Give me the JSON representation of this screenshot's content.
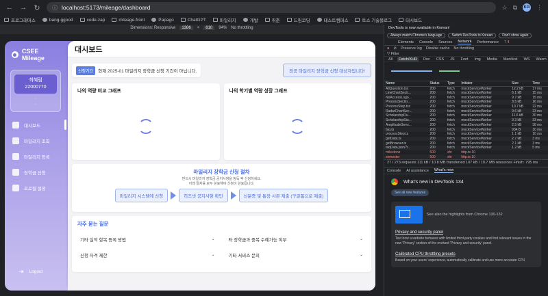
{
  "browser": {
    "url": "localhost:5173/mileage/dashboard",
    "bookmarks": [
      "프로그래머스",
      "bang-ggood",
      "code-zap",
      "mileage-front",
      "Papago",
      "ChatGPT",
      "마일리지",
      "개발",
      "취준",
      "드림코딩",
      "테스트캠퍼스",
      "토스 기술블로그",
      "대시보드"
    ],
    "profile_initials": "KG"
  },
  "device_toolbar": {
    "mode": "Dimensions: Responsive",
    "width": "1386",
    "height": "810",
    "zoom": "94%",
    "throttle": "No throttling"
  },
  "app": {
    "logo": "CSEE Mileage",
    "user": {
      "name": "최혜림",
      "id": "22000770",
      "dots": "·\n·"
    },
    "menu": [
      {
        "label": "대시보드",
        "active": true
      },
      {
        "label": "마일리지 조회"
      },
      {
        "label": "마일리지 등록"
      },
      {
        "label": "장학금 신청"
      },
      {
        "label": "프로필 설정"
      }
    ],
    "logout": "Logout",
    "page_title": "대시보드",
    "notice_badge": "신청기간",
    "notice_text": "현재 2025-01 마일리지 장학금 신청 기간이 아닙니다.",
    "target_button": "전공 마일리지 장학금 신청 대상자입니다!",
    "chart1_title": "나의 역량 비교 그래프",
    "chart2_title": "나의 학기별 역량 성장 그래프",
    "process_title": "마일리지 장학금 신청 절차",
    "process_desc1": "반드시 마일리지 장학금 공지사항을 정독 후 신청하세요.",
    "process_desc2": "아래 절차를 모두 완료해야 신청이 완료됩니다.",
    "steps": [
      "마일리지 시스템에 신청",
      "히즈넷 공지사항 확인",
      "신분증 및 통장 사본 제출 (구글폼으로 제출)"
    ],
    "faq_title": "자주 묻는 질문",
    "faq": [
      "기타 실적 항목 등록 방법",
      "타 장학금과 중복 수혜가능 여부",
      "신청 자격 제한",
      "기타 서비스 문의"
    ]
  },
  "devtools": {
    "notice": "DevTools is now available in Korean!",
    "btns": [
      "Always match Chrome's language",
      "Switch DevTools to Korean",
      "Don't show again"
    ],
    "tabs": [
      "Elements",
      "Console",
      "Sources",
      "Network",
      "Performance"
    ],
    "badges": "7  4",
    "filters": [
      "All",
      "Fetch/XHR",
      "Doc",
      "CSS",
      "JS",
      "Font",
      "Img",
      "Media",
      "Manifest",
      "WS",
      "Wasm",
      "Other"
    ],
    "checks": [
      "Preserve log",
      "Disable cache",
      "No throttling"
    ],
    "columns": [
      "Name",
      "Status",
      "Type",
      "Initiator",
      "Size",
      "Time"
    ],
    "rows": [
      {
        "name": "AllQuestion.tsx",
        "status": "200",
        "type": "fetch",
        "init": "mockServiceWorker",
        "size": "12.2 kB",
        "time": "17 ms"
      },
      {
        "name": "LineChartSecti...",
        "status": "200",
        "type": "fetch",
        "init": "mockServiceWorker",
        "size": "6.1 kB",
        "time": "15 ms"
      },
      {
        "name": "NoAccessLogo...",
        "status": "200",
        "type": "fetch",
        "init": "mockServiceWorker",
        "size": "9.7 kB",
        "time": "15 ms"
      },
      {
        "name": "ProcessSectio...",
        "status": "200",
        "type": "fetch",
        "init": "mockServiceWorker",
        "size": "8.5 kB",
        "time": "16 ms"
      },
      {
        "name": "ProcessStep.tsx",
        "status": "200",
        "type": "fetch",
        "init": "mockServiceWorker",
        "size": "10.7 kB",
        "time": "22 ms"
      },
      {
        "name": "RadarChartSec...",
        "status": "200",
        "type": "fetch",
        "init": "mockServiceWorker",
        "size": "9.6 kB",
        "time": "23 ms"
      },
      {
        "name": "ScholarshipDu...",
        "status": "200",
        "type": "fetch",
        "init": "mockServiceWorker",
        "size": "11.6 kB",
        "time": "30 ms"
      },
      {
        "name": "ScholarshipStu...",
        "status": "200",
        "type": "fetch",
        "init": "mockServiceWorker",
        "size": "9.3 kB",
        "time": "33 ms"
      },
      {
        "name": "AmplitudeServi...",
        "status": "200",
        "type": "fetch",
        "init": "mockServiceWorker",
        "size": "2.5 kB",
        "time": "38 ms"
      },
      {
        "name": "faq.ts",
        "status": "200",
        "type": "fetch",
        "init": "mockServiceWorker",
        "size": "934 B",
        "time": "10 ms"
      },
      {
        "name": "processStep.ts",
        "status": "200",
        "type": "fetch",
        "init": "mockServiceWorker",
        "size": "1.1 kB",
        "time": "10 ms"
      },
      {
        "name": "getData.ts",
        "status": "200",
        "type": "fetch",
        "init": "mockServiceWorker",
        "size": "2.7 kB",
        "time": "3 ms"
      },
      {
        "name": "getBrowser.ts",
        "status": "200",
        "type": "fetch",
        "init": "mockServiceWorker",
        "size": "2.1 kB",
        "time": "3 ms"
      },
      {
        "name": "faqData.json?i...",
        "status": "200",
        "type": "fetch",
        "init": "mockServiceWorker",
        "size": "1.2 kB",
        "time": "5 ms"
      },
      {
        "name": "milestone",
        "status": "500",
        "type": "xhr",
        "init": "http.ts:10",
        "size": "",
        "time": "",
        "err": true
      },
      {
        "name": "semester",
        "status": "500",
        "type": "xhr",
        "init": "http.ts:10",
        "size": "",
        "time": "",
        "err": true
      }
    ],
    "status_bar": "27 / 273 requests    111 kB / 10.8 MB transferred    107 kB / 10.7 MB resources    Finish: 795 ms",
    "drawer_tabs": [
      "Console",
      "AI assistance",
      "What's new"
    ],
    "whatsnew_title": "What's new in DevTools 134",
    "see_all": "See all new features",
    "highlight": "See also the highlights from Chrome 130-132",
    "item1_title": "Privacy and security panel",
    "item1_text": "Test how a website behaves with limited third-party cookies and find relevant issues in the new 'Privacy' section of the evolved 'Privacy and security' panel.",
    "item2_title": "Calibrated CPU throttling presets",
    "item2_text": "Based on your users' experience, automatically calibrate and use more accurate CPU"
  }
}
